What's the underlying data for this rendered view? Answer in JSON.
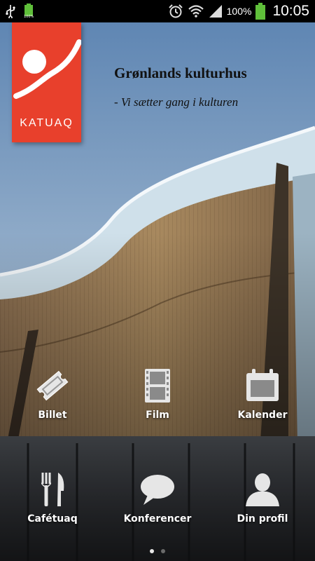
{
  "status_bar": {
    "time": "10:05",
    "battery_percent": "100%",
    "mini_battery_percent": "100%",
    "icons": [
      "usb-icon",
      "battery-small-icon",
      "alarm-icon",
      "wifi-icon",
      "signal-icon",
      "battery-icon"
    ]
  },
  "app": {
    "logo_text": "KATUAQ",
    "headline": "Grønlands kulturhus",
    "tagline": "- Vi sætter gang i kulturen"
  },
  "menu": {
    "row1": [
      {
        "label": "Billet",
        "icon": "ticket-icon"
      },
      {
        "label": "Film",
        "icon": "film-strip-icon"
      },
      {
        "label": "Kalender",
        "icon": "calendar-icon"
      }
    ],
    "row2": [
      {
        "label": "Cafétuaq",
        "icon": "fork-knife-icon"
      },
      {
        "label": "Konferencer",
        "icon": "speech-bubble-icon"
      },
      {
        "label": "Din profil",
        "icon": "person-icon"
      }
    ]
  },
  "pager": {
    "pages": 2,
    "active_page": 1
  },
  "colors": {
    "brand": "#e8402c",
    "sky": "#7d9dbd",
    "wood": "#9b7c58",
    "label": "#ffffff"
  }
}
